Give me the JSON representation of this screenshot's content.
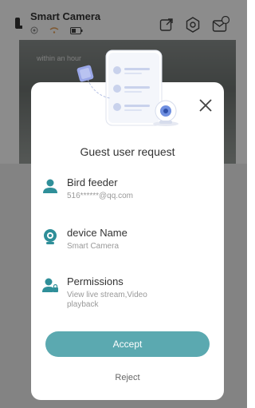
{
  "header": {
    "title": "Smart Camera",
    "icons": [
      "device-icon",
      "signal-icon",
      "wifi-icon",
      "battery-icon",
      "share-icon",
      "settings-icon",
      "messages-icon"
    ]
  },
  "camera_feed": {
    "overlay_text": "within an hour"
  },
  "modal": {
    "title": "Guest user request",
    "rows": [
      {
        "label": "Bird feeder",
        "value": "516******@qq.com",
        "icon": "user-icon"
      },
      {
        "label": "device Name",
        "value": "Smart Camera",
        "icon": "camera-icon"
      },
      {
        "label": "Permissions",
        "value": "View live stream,Video playback",
        "icon": "user-lock-icon"
      }
    ],
    "accept_label": "Accept",
    "reject_label": "Reject"
  },
  "colors": {
    "accent": "#5ba9b0",
    "icon_teal": "#2f8f99"
  }
}
